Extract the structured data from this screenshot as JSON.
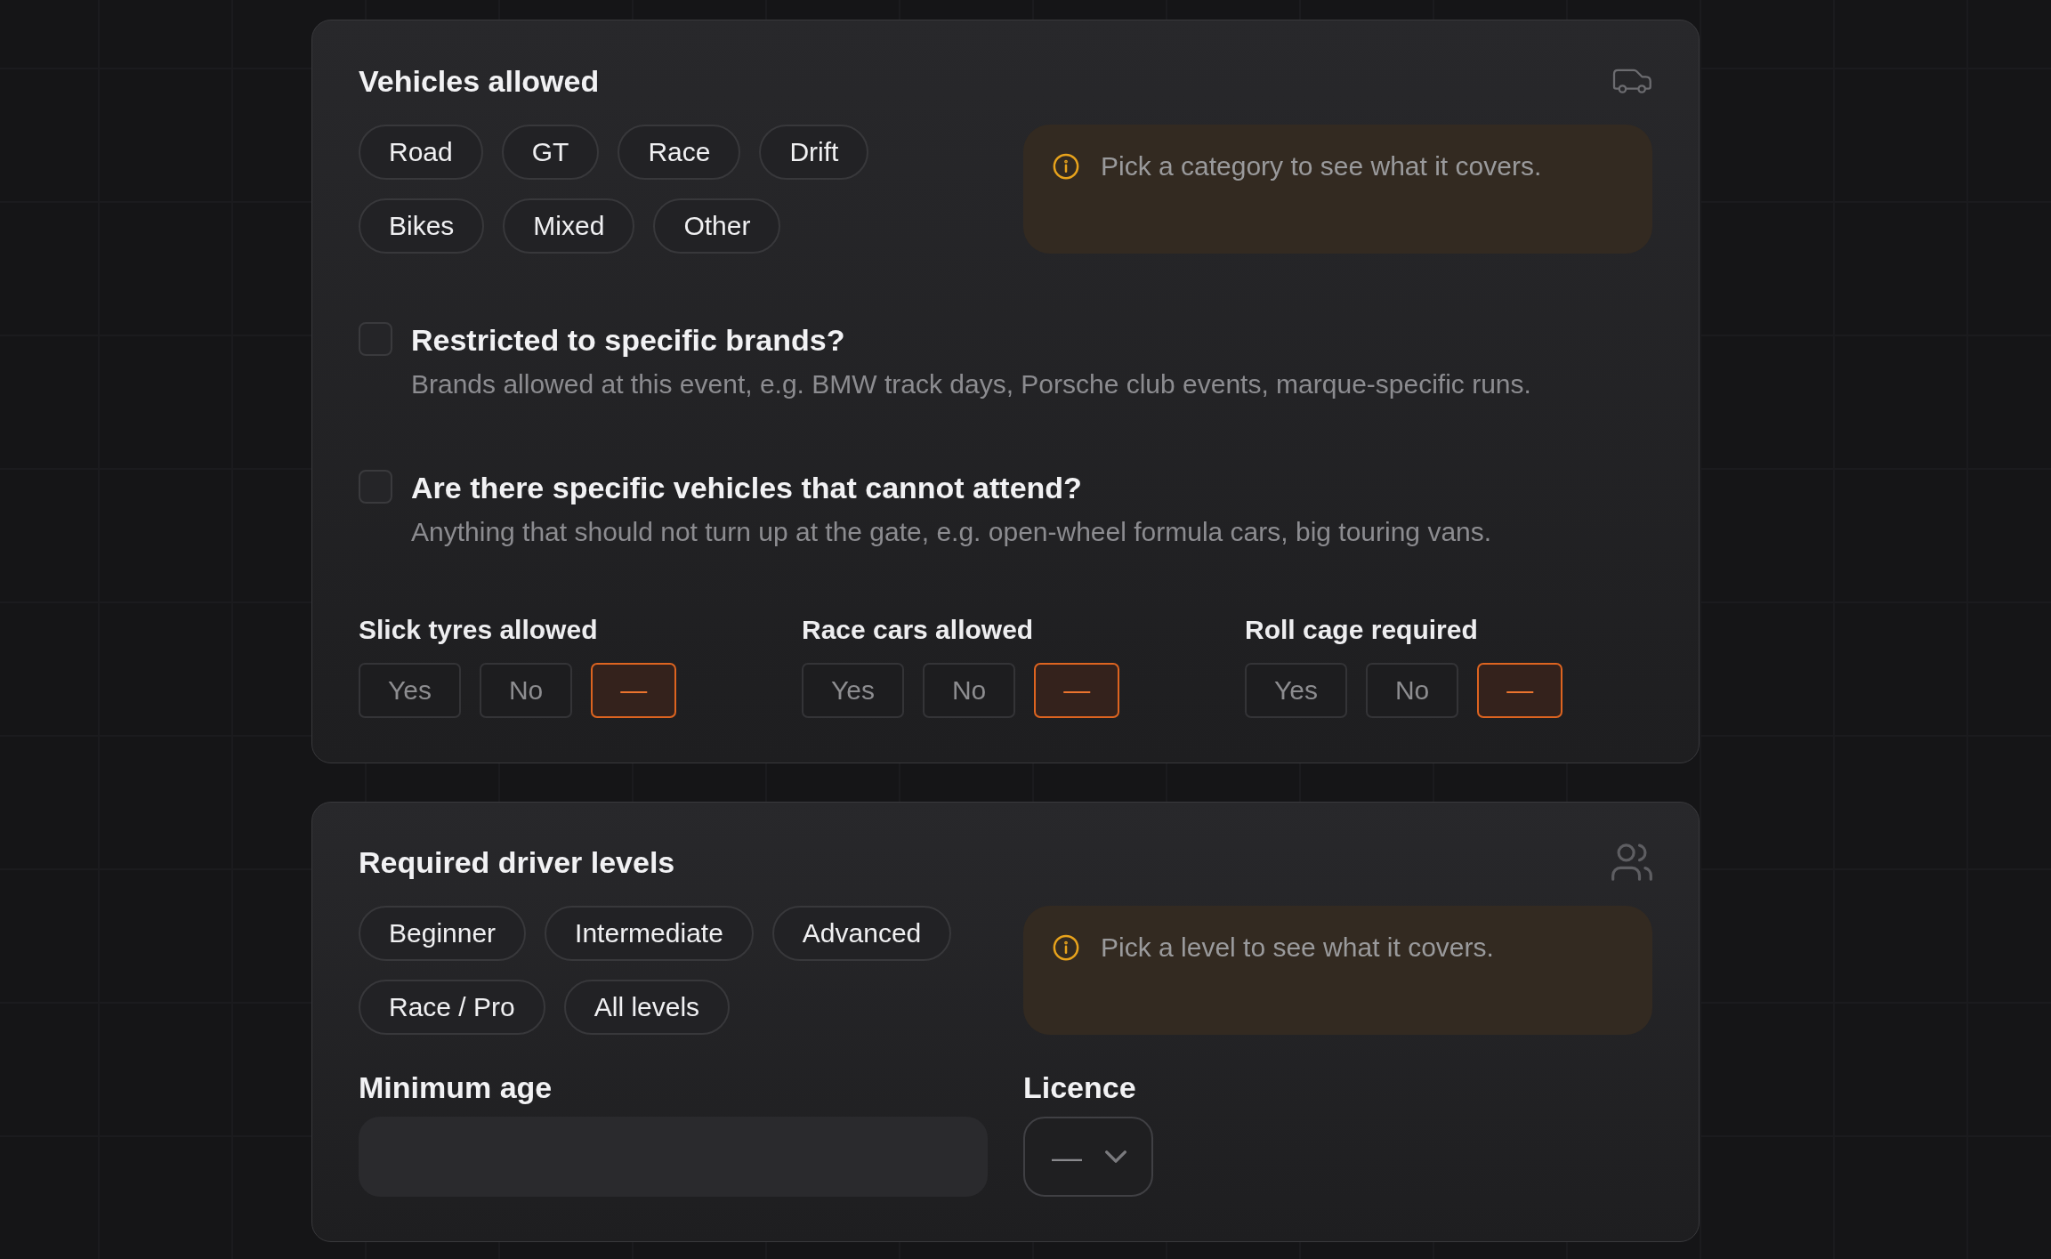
{
  "vehicles_card": {
    "title": "Vehicles allowed",
    "categories": [
      {
        "label": "Road",
        "selected": false
      },
      {
        "label": "GT",
        "selected": false
      },
      {
        "label": "Race",
        "selected": false
      },
      {
        "label": "Drift",
        "selected": false
      },
      {
        "label": "Bikes",
        "selected": false
      },
      {
        "label": "Mixed",
        "selected": false
      },
      {
        "label": "Other",
        "selected": false
      }
    ],
    "info": "Pick a category to see what it covers.",
    "questions": [
      {
        "title": "Restricted to specific brands?",
        "description": "Brands allowed at this event, e.g. BMW track days, Porsche club events, marque-specific runs.",
        "checked": false
      },
      {
        "title": "Are there specific vehicles that cannot attend?",
        "description": "Anything that should not turn up at the gate, e.g. open-wheel formula cars, big touring vans.",
        "checked": false
      }
    ],
    "toggles": [
      {
        "label": "Slick tyres allowed",
        "options": [
          {
            "label": "Yes",
            "selected": false
          },
          {
            "label": "No",
            "selected": false
          },
          {
            "label": "—",
            "selected": true
          }
        ]
      },
      {
        "label": "Race cars allowed",
        "options": [
          {
            "label": "Yes",
            "selected": false
          },
          {
            "label": "No",
            "selected": false
          },
          {
            "label": "—",
            "selected": true
          }
        ]
      },
      {
        "label": "Roll cage required",
        "options": [
          {
            "label": "Yes",
            "selected": false
          },
          {
            "label": "No",
            "selected": false
          },
          {
            "label": "—",
            "selected": true
          }
        ]
      }
    ]
  },
  "driver_card": {
    "title": "Required driver levels",
    "levels": [
      {
        "label": "Beginner",
        "selected": false
      },
      {
        "label": "Intermediate",
        "selected": false
      },
      {
        "label": "Advanced",
        "selected": false
      },
      {
        "label": "Race / Pro",
        "selected": false
      },
      {
        "label": "All levels",
        "selected": false
      }
    ],
    "info": "Pick a level to see what it covers.",
    "minimum_age": {
      "label": "Minimum age"
    },
    "licence": {
      "label": "Licence",
      "value": "—"
    }
  }
}
